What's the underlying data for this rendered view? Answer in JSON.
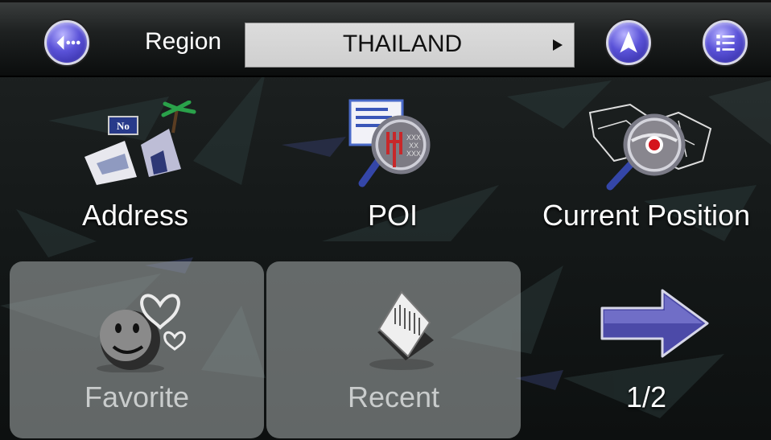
{
  "header": {
    "region_label": "Region",
    "region_value": "THAILAND"
  },
  "icons": {
    "back": "back-icon",
    "navigate": "navigate-arrow-icon",
    "menu": "menu-list-icon",
    "next": "right-arrow-icon"
  },
  "menu": {
    "address": {
      "label": "Address",
      "icon": "address-icon"
    },
    "poi": {
      "label": "POI",
      "icon": "poi-search-icon"
    },
    "current_position": {
      "label": "Current Position",
      "icon": "current-position-icon"
    },
    "favorite": {
      "label": "Favorite",
      "icon": "favorite-icon"
    },
    "recent": {
      "label": "Recent",
      "icon": "recent-icon"
    },
    "page_indicator": "1/2"
  },
  "colors": {
    "button_accent": "#5a52d8",
    "disabled_tile": "#a9adad"
  }
}
